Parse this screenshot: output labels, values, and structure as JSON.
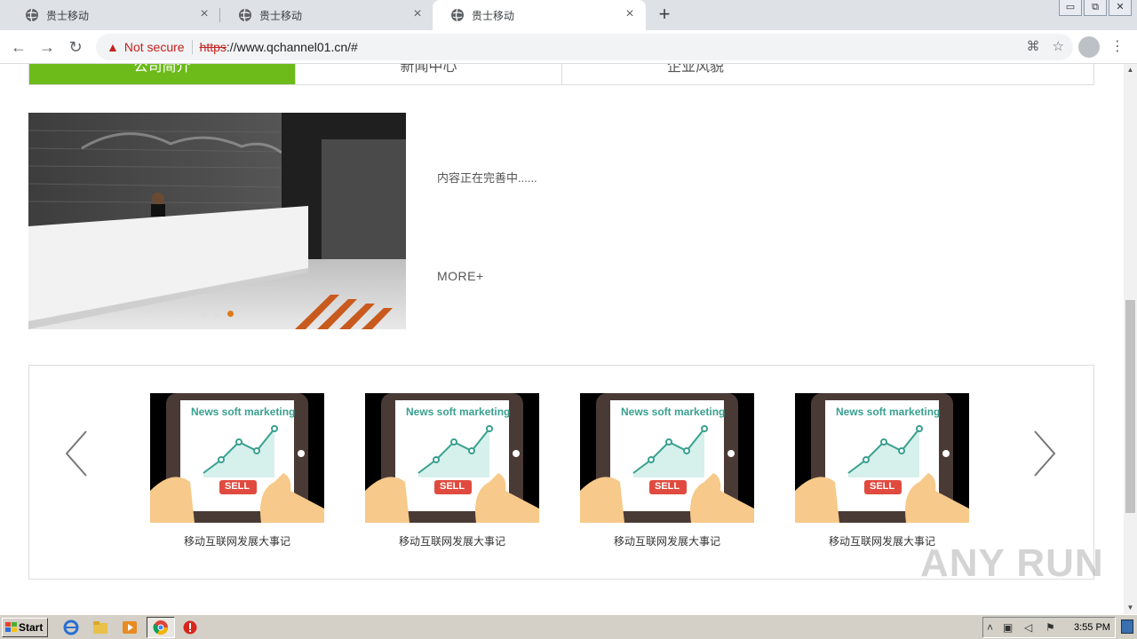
{
  "browser": {
    "tabs": [
      {
        "title": "贵士移动",
        "active": false
      },
      {
        "title": "贵士移动",
        "active": false
      },
      {
        "title": "贵士移动",
        "active": true
      }
    ],
    "security_label": "Not secure",
    "url_scheme": "https",
    "url_rest": "://www.qchannel01.cn/#"
  },
  "page": {
    "nav_tabs": [
      "公司简介",
      "新闻中心",
      "企业风貌"
    ],
    "active_nav": 0,
    "intro_text": "内容正在完善中......",
    "more_label": "MORE+",
    "slider_dots": 3,
    "slider_active_dot": 2,
    "cards": [
      {
        "image_text": "News soft marketing",
        "button_text": "SELL",
        "caption": "移动互联网发展大事记"
      },
      {
        "image_text": "News soft marketing",
        "button_text": "SELL",
        "caption": "移动互联网发展大事记"
      },
      {
        "image_text": "News soft marketing",
        "button_text": "SELL",
        "caption": "移动互联网发展大事记"
      },
      {
        "image_text": "News soft marketing",
        "button_text": "SELL",
        "caption": "移动互联网发展大事记"
      }
    ],
    "watermark": "ANY RUN"
  },
  "taskbar": {
    "start_label": "Start",
    "clock": "3:55 PM"
  },
  "colors": {
    "nav_active": "#6dbb1a",
    "dot_active": "#e07b1a",
    "insecure_red": "#c5221f"
  }
}
